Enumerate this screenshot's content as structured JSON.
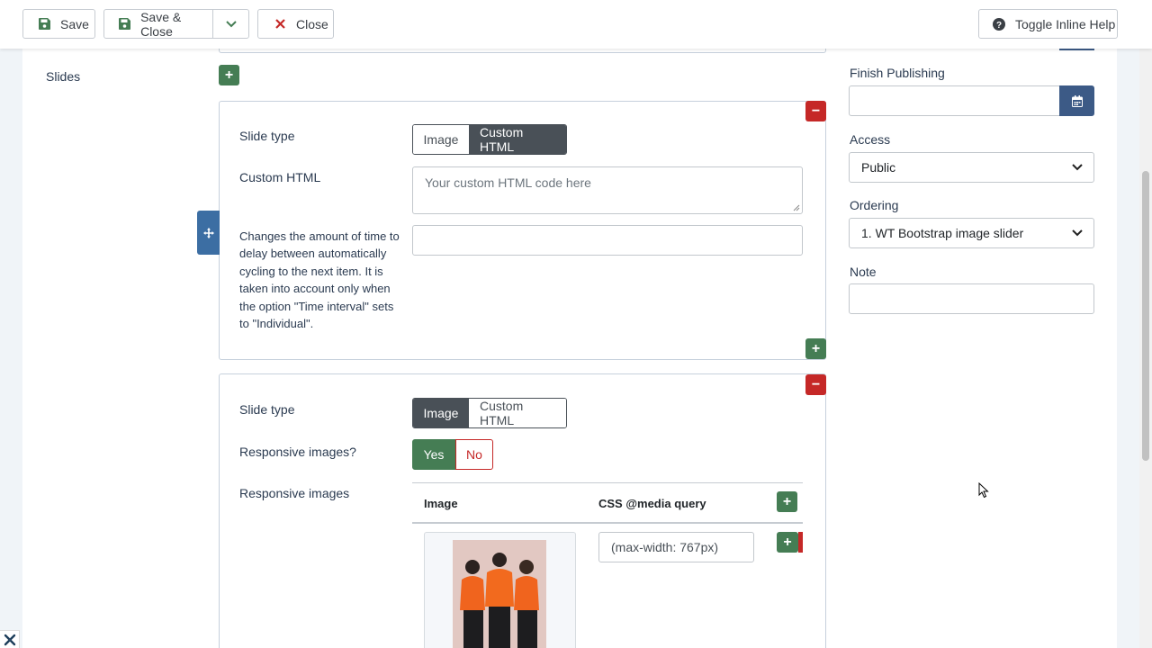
{
  "toolbar": {
    "save_label": "Save",
    "save_close_label": "Save & Close",
    "close_label": "Close",
    "help_label": "Toggle Inline Help"
  },
  "slides": {
    "label": "Slides",
    "slide1": {
      "type_label": "Slide type",
      "type_options": [
        "Image",
        "Custom HTML"
      ],
      "type_selected": "Custom HTML",
      "html_label": "Custom HTML",
      "html_placeholder": "Your custom HTML code here",
      "interval_description": "Changes the amount of time to delay between automatically cycling to the next item. It is taken into account only when the option \"Time interval\" sets to \"Individual\".",
      "interval_value": ""
    },
    "slide2": {
      "type_label": "Slide type",
      "type_options": [
        "Image",
        "Custom HTML"
      ],
      "type_selected": "Image",
      "responsive_label": "Responsive images?",
      "responsive_yes": "Yes",
      "responsive_no": "No",
      "responsive_images_label": "Responsive images",
      "table": {
        "col_image": "Image",
        "col_media": "CSS @media query",
        "rows": [
          {
            "media_query": "(max-width: 767px)"
          }
        ]
      }
    }
  },
  "sidebar": {
    "finish_publishing_label": "Finish Publishing",
    "finish_publishing_value": "",
    "access_label": "Access",
    "access_value": "Public",
    "ordering_label": "Ordering",
    "ordering_value": "1. WT Bootstrap image slider",
    "note_label": "Note",
    "note_value": ""
  },
  "colors": {
    "green": "#457d54",
    "red": "#c52827",
    "dark": "#495057",
    "blue": "#3c5a86"
  }
}
